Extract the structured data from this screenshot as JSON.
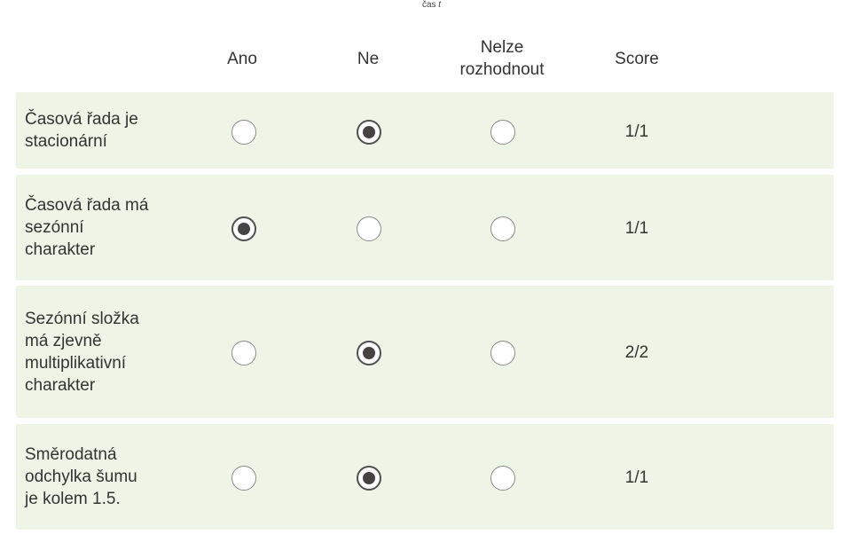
{
  "caption": {
    "prefix": "čas",
    "variable": "t"
  },
  "columns": {
    "ano": "Ano",
    "ne": "Ne",
    "nelze_line1": "Nelze",
    "nelze_line2": "rozhodnout",
    "score": "Score"
  },
  "rows": [
    {
      "label_lines": [
        "Časová řada je",
        "stacionární"
      ],
      "selected": "ne",
      "score": "1/1"
    },
    {
      "label_lines": [
        "Časová řada má",
        "sezónní",
        "charakter"
      ],
      "selected": "ano",
      "score": "1/1"
    },
    {
      "label_lines": [
        "Sezónní složka",
        "má zjevně",
        "multiplikativní",
        "charakter"
      ],
      "selected": "ne",
      "score": "2/2"
    },
    {
      "label_lines": [
        "Směrodatná",
        "odchylka šumu",
        "je kolem 1.5."
      ],
      "selected": "ne",
      "score": "1/1"
    }
  ],
  "colors": {
    "row_background": "#eef5e6",
    "radio_border": "#8a8a8a",
    "radio_dot": "#444444"
  }
}
